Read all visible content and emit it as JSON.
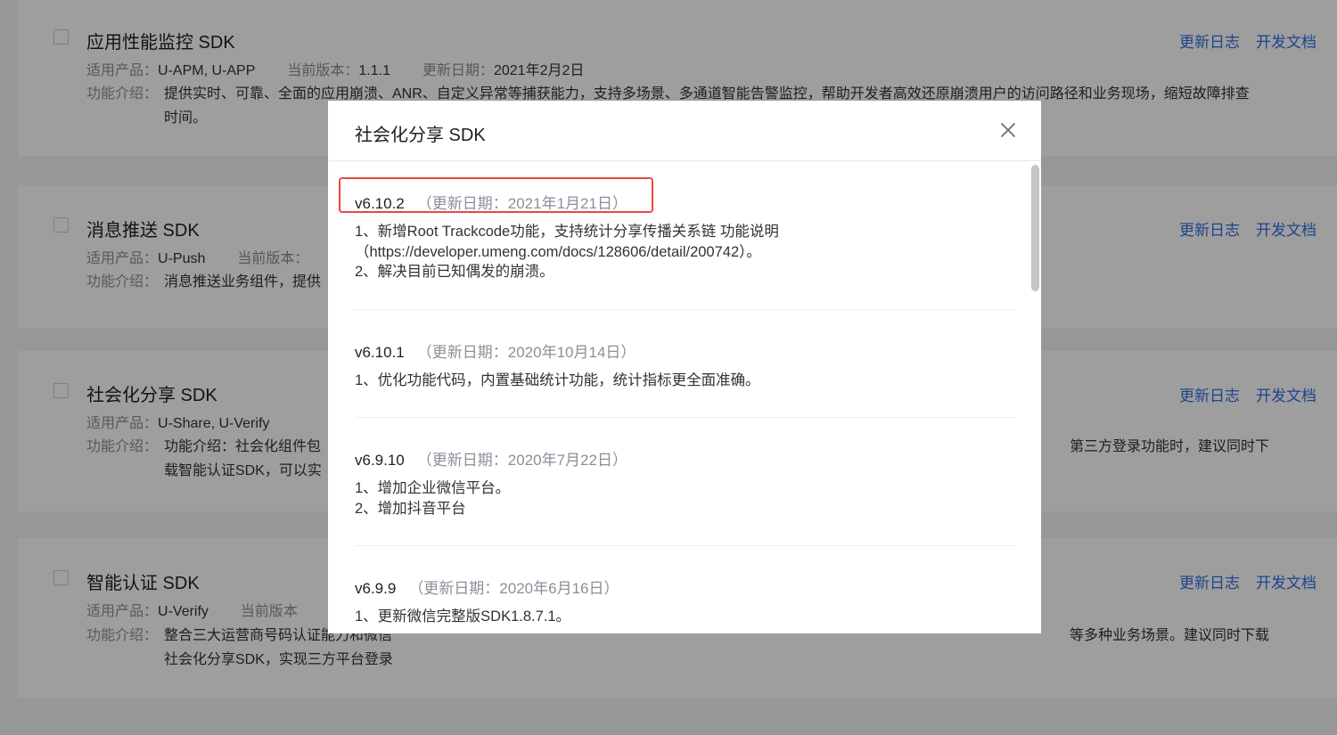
{
  "sdk_list": [
    {
      "title": "应用性能监控 SDK",
      "products_label": "适用产品：",
      "products": "U-APM, U-APP",
      "version_label": "当前版本：",
      "version": "1.1.1",
      "date_label": "更新日期：",
      "date": "2021年2月2日",
      "desc_label": "功能介绍：",
      "desc": "提供实时、可靠、全面的应用崩溃、ANR、自定义异常等捕获能力，支持多场景、多通道智能告警监控，帮助开发者高效还原崩溃用户的访问路径和业务现场，缩短故障排查时间。",
      "changelog_label": "更新日志",
      "docs_label": "开发文档"
    },
    {
      "title": "消息推送 SDK",
      "products_label": "适用产品：",
      "products": "U-Push",
      "version_label": "当前版本：",
      "desc_label": "功能介绍：",
      "desc": "消息推送业务组件，提供",
      "changelog_label": "更新日志",
      "docs_label": "开发文档"
    },
    {
      "title": "社会化分享 SDK",
      "products_label": "适用产品：",
      "products": "U-Share, U-Verify",
      "desc_label": "功能介绍：",
      "desc_line1_start": "功能介绍：社会化组件包",
      "desc_line1_end": "第三方登录功能时，建议同时下",
      "desc_line2": "载智能认证SDK，可以实",
      "changelog_label": "更新日志",
      "docs_label": "开发文档"
    },
    {
      "title": "智能认证 SDK",
      "products_label": "适用产品：",
      "products": "U-Verify",
      "version_label": "当前版本",
      "desc_label": "功能介绍：",
      "desc_line1_start": "整合三大运营商号码认证能力和微信",
      "desc_line1_end": "等多种业务场景。建议同时下载",
      "desc_line2": "社会化分享SDK，实现三方平台登录",
      "changelog_label": "更新日志",
      "docs_label": "开发文档"
    }
  ],
  "modal": {
    "title": "社会化分享 SDK",
    "close_icon": "close-icon",
    "releases": [
      {
        "version": "v6.10.2",
        "date": "（更新日期：2021年1月21日）",
        "highlighted": true,
        "notes": [
          "1、新增Root Trackcode功能，支持统计分享传播关系链 功能说明",
          "（https://developer.umeng.com/docs/128606/detail/200742）。",
          "2、解决目前已知偶发的崩溃。"
        ]
      },
      {
        "version": "v6.10.1",
        "date": "（更新日期：2020年10月14日）",
        "notes": [
          "1、优化功能代码，内置基础统计功能，统计指标更全面准确。"
        ]
      },
      {
        "version": "v6.9.10",
        "date": "（更新日期：2020年7月22日）",
        "notes": [
          "1、增加企业微信平台。",
          "2、增加抖音平台"
        ]
      },
      {
        "version": "v6.9.9",
        "date": "（更新日期：2020年6月16日）",
        "notes": [
          "1、更新微信完整版SDK1.8.7.1。"
        ]
      }
    ]
  },
  "colors": {
    "link": "#2f6fe4",
    "highlight_border": "#e8483b",
    "label_gray": "#8a8f99"
  }
}
